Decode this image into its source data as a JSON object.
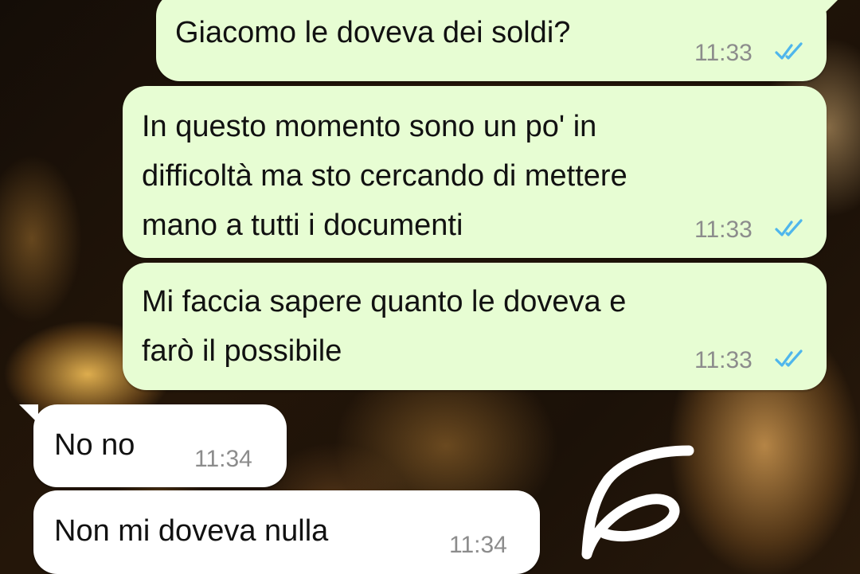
{
  "messages": [
    {
      "direction": "out",
      "text": "Giacomo le doveva dei soldi?",
      "time": "11:33",
      "status": "read-double-check-icon"
    },
    {
      "direction": "out",
      "text": "In questo momento sono un po' in\ndifficoltà ma sto cercando di mettere\nmano a tutti i documenti",
      "time": "11:33",
      "status": "read-double-check-icon"
    },
    {
      "direction": "out",
      "text": "Mi faccia sapere quanto le doveva e\nfarò il possibile",
      "time": "11:33",
      "status": "read-double-check-icon"
    },
    {
      "direction": "in",
      "text": "No no",
      "time": "11:34"
    },
    {
      "direction": "in",
      "text": "Non mi doveva nulla",
      "time": "11:34"
    }
  ],
  "colors": {
    "outgoing_bubble": "#e7fdd3",
    "incoming_bubble": "#ffffff",
    "read_ticks": "#4fb6ec",
    "timestamp": "#8c8c8c"
  },
  "annotation": {
    "icon": "handwritten-scribble-icon",
    "color": "#ffffff"
  }
}
